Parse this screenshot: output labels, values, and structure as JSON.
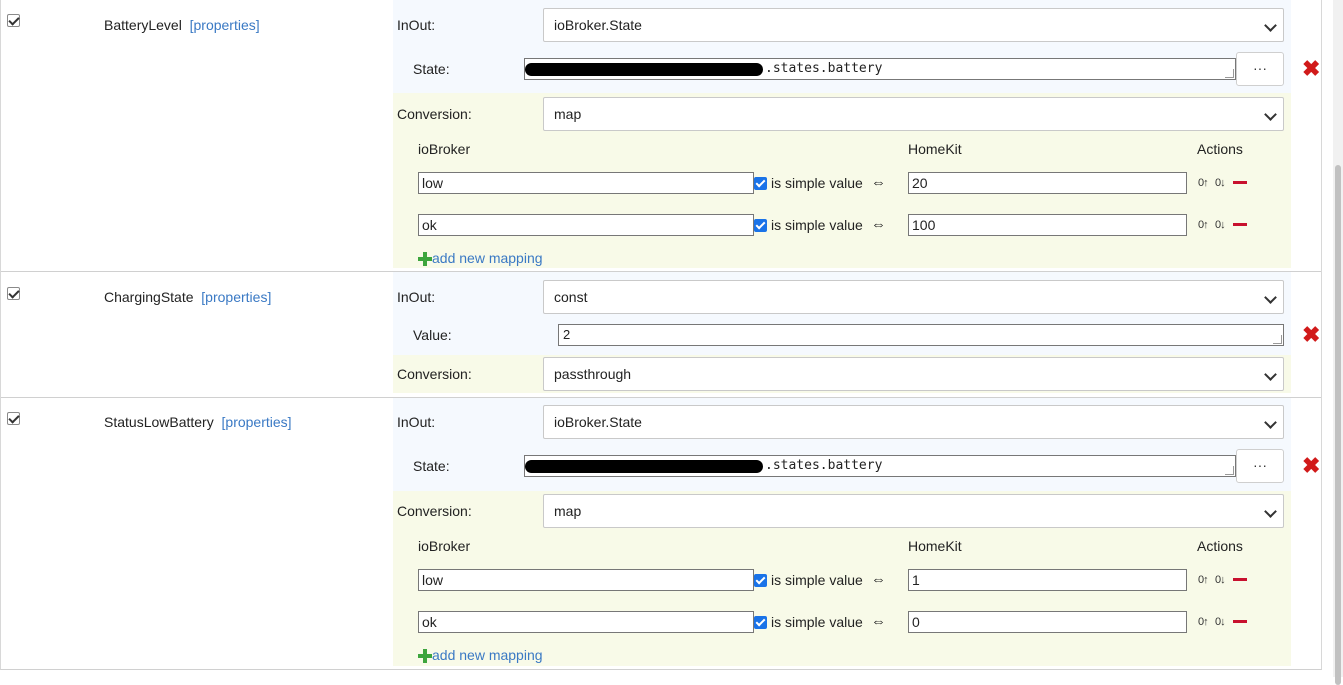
{
  "rows": [
    {
      "name": "BatteryLevel",
      "properties_link": "[properties]",
      "inout_label": "InOut:",
      "inout_value": "ioBroker.State",
      "state_label": "State:",
      "state_value": ".states.battery",
      "browse_label": "···",
      "conversion_label": "Conversion:",
      "conversion_value": "map",
      "mapping": {
        "header_iobroker": "ioBroker",
        "header_homekit": "HomeKit",
        "header_actions": "Actions",
        "simple_label": "is simple value",
        "arrow": "⇔",
        "entries": [
          {
            "iobroker": "low",
            "homekit": "20"
          },
          {
            "iobroker": "ok",
            "homekit": "100"
          }
        ],
        "add_label": "add new mapping"
      }
    },
    {
      "name": "ChargingState",
      "properties_link": "[properties]",
      "inout_label": "InOut:",
      "inout_value": "const",
      "value_label": "Value:",
      "value_value": "2",
      "conversion_label": "Conversion:",
      "conversion_value": "passthrough"
    },
    {
      "name": "StatusLowBattery",
      "properties_link": "[properties]",
      "inout_label": "InOut:",
      "inout_value": "ioBroker.State",
      "state_label": "State:",
      "state_value": ".states.battery",
      "browse_label": "···",
      "conversion_label": "Conversion:",
      "conversion_value": "map",
      "mapping": {
        "header_iobroker": "ioBroker",
        "header_homekit": "HomeKit",
        "header_actions": "Actions",
        "simple_label": "is simple value",
        "arrow": "⇔",
        "entries": [
          {
            "iobroker": "low",
            "homekit": "1"
          },
          {
            "iobroker": "ok",
            "homekit": "0"
          }
        ],
        "add_label": "add new mapping"
      }
    }
  ],
  "icons": {
    "move_up": "0↑",
    "move_down": "0↓",
    "delete": "✖"
  },
  "colors": {
    "link": "#3a79c4",
    "delete": "#d11a1a",
    "add": "#3da53d",
    "blue_panel": "#f5f9fe",
    "yellow_panel": "#f8fae8"
  }
}
